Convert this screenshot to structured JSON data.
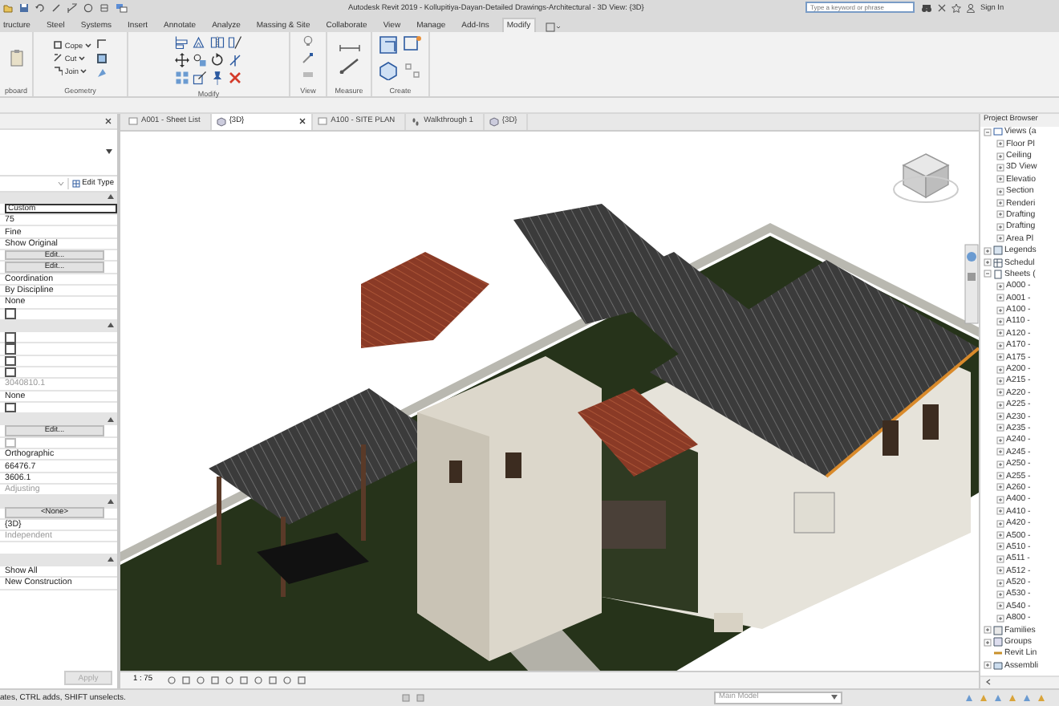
{
  "window": {
    "title": "Autodesk Revit 2019 - Kollupitiya-Dayan-Detailed Drawings-Architectural - 3D View: {3D}"
  },
  "search": {
    "placeholder": "Type a keyword or phrase"
  },
  "account": {
    "label": "Sign In"
  },
  "ribbon": {
    "tabs": [
      {
        "label": "tructure",
        "selected": false
      },
      {
        "label": "Steel",
        "selected": false
      },
      {
        "label": "Systems",
        "selected": false
      },
      {
        "label": "Insert",
        "selected": false
      },
      {
        "label": "Annotate",
        "selected": false
      },
      {
        "label": "Analyze",
        "selected": false
      },
      {
        "label": "Massing & Site",
        "selected": false
      },
      {
        "label": "Collaborate",
        "selected": false
      },
      {
        "label": "View",
        "selected": false
      },
      {
        "label": "Manage",
        "selected": false
      },
      {
        "label": "Add-Ins",
        "selected": false
      },
      {
        "label": "Modify",
        "selected": true
      }
    ],
    "panels": [
      {
        "label": "pboard",
        "kind": "clipboard"
      },
      {
        "label": "Geometry",
        "kind": "geometry",
        "tools": [
          "Cope",
          "Cut",
          "Join"
        ]
      },
      {
        "label": "Modify",
        "kind": "modify"
      },
      {
        "label": "View",
        "kind": "view"
      },
      {
        "label": "Measure",
        "kind": "measure"
      },
      {
        "label": "Create",
        "kind": "create"
      }
    ]
  },
  "properties": {
    "edit_type": "Edit Type",
    "rows": [
      {
        "kind": "header",
        "expanded": true
      },
      {
        "kind": "field",
        "value": "Custom"
      },
      {
        "kind": "text",
        "value": "75",
        "disabled": false
      },
      {
        "kind": "text",
        "value": "Fine",
        "disabled": false
      },
      {
        "kind": "text",
        "value": "Show Original",
        "disabled": false
      },
      {
        "kind": "button",
        "value": "Edit..."
      },
      {
        "kind": "button",
        "value": "Edit..."
      },
      {
        "kind": "text",
        "value": "Coordination",
        "disabled": false
      },
      {
        "kind": "text",
        "value": "By Discipline",
        "disabled": false
      },
      {
        "kind": "text",
        "value": "None",
        "disabled": false
      },
      {
        "kind": "checkbox",
        "checked": false,
        "disabled": false
      },
      {
        "kind": "header",
        "expanded": true
      },
      {
        "kind": "checkbox",
        "checked": false,
        "disabled": false
      },
      {
        "kind": "checkbox",
        "checked": false,
        "disabled": false
      },
      {
        "kind": "checkbox",
        "checked": false,
        "disabled": false
      },
      {
        "kind": "checkbox",
        "checked": false,
        "disabled": false
      },
      {
        "kind": "text",
        "value": "3040810.1",
        "disabled": true
      },
      {
        "kind": "text",
        "value": "None",
        "disabled": false
      },
      {
        "kind": "checkbox",
        "checked": false,
        "disabled": false
      },
      {
        "kind": "header",
        "expanded": true
      },
      {
        "kind": "button",
        "value": "Edit..."
      },
      {
        "kind": "checkbox",
        "checked": false,
        "disabled": true
      },
      {
        "kind": "text",
        "value": "Orthographic",
        "disabled": false
      },
      {
        "kind": "text",
        "value": "66476.7",
        "disabled": false
      },
      {
        "kind": "text",
        "value": "3606.1",
        "disabled": false
      },
      {
        "kind": "text",
        "value": "Adjusting",
        "disabled": true
      },
      {
        "kind": "header",
        "expanded": true
      },
      {
        "kind": "button",
        "value": "<None>"
      },
      {
        "kind": "text",
        "value": "{3D}",
        "disabled": false
      },
      {
        "kind": "text",
        "value": "Independent",
        "disabled": true
      },
      {
        "kind": "blank"
      },
      {
        "kind": "header",
        "expanded": true
      },
      {
        "kind": "text",
        "value": "Show All",
        "disabled": false
      },
      {
        "kind": "text",
        "value": "New Construction",
        "disabled": false
      }
    ],
    "apply": {
      "label": "Apply",
      "disabled": true
    }
  },
  "view_tabs": [
    {
      "label": "A001 - Sheet List",
      "kind": "sheet",
      "selected": false
    },
    {
      "label": "{3D}",
      "kind": "model",
      "selected": true
    },
    {
      "label": "A100 - SITE PLAN",
      "kind": "sheet",
      "selected": false
    },
    {
      "label": "Walkthrough 1",
      "kind": "walkthrough",
      "selected": false
    },
    {
      "label": "{3D}",
      "kind": "model",
      "selected": false
    }
  ],
  "view": {
    "scale": "1 : 75"
  },
  "project_browser": {
    "title": "Project Browser",
    "tree": [
      {
        "label": "Views (a",
        "kind": "views",
        "expanded": true,
        "children": [
          {
            "label": "Floor Pl",
            "expanded": false
          },
          {
            "label": "Ceiling",
            "expanded": false
          },
          {
            "label": "3D View",
            "expanded": false
          },
          {
            "label": "Elevatio",
            "expanded": false
          },
          {
            "label": "Section",
            "expanded": false
          },
          {
            "label": "Renderi",
            "expanded": false
          },
          {
            "label": "Drafting",
            "expanded": false
          },
          {
            "label": "Drafting",
            "expanded": false
          },
          {
            "label": "Area Pl",
            "expanded": false
          }
        ]
      },
      {
        "label": "Legends",
        "kind": "legends",
        "expanded": false
      },
      {
        "label": "Schedul",
        "kind": "schedules",
        "expanded": false
      },
      {
        "label": "Sheets (",
        "kind": "sheets",
        "expanded": true,
        "children": [
          {
            "label": "A000 -",
            "expanded": false
          },
          {
            "label": "A001 -",
            "expanded": false
          },
          {
            "label": "A100 -",
            "expanded": false
          },
          {
            "label": "A110 -",
            "expanded": false
          },
          {
            "label": "A120 -",
            "expanded": false
          },
          {
            "label": "A170 -",
            "expanded": false
          },
          {
            "label": "A175 -",
            "expanded": false
          },
          {
            "label": "A200 -",
            "expanded": false
          },
          {
            "label": "A215 -",
            "expanded": false
          },
          {
            "label": "A220 -",
            "expanded": false
          },
          {
            "label": "A225 -",
            "expanded": false
          },
          {
            "label": "A230 -",
            "expanded": false
          },
          {
            "label": "A235 -",
            "expanded": false
          },
          {
            "label": "A240 -",
            "expanded": false
          },
          {
            "label": "A245 -",
            "expanded": false
          },
          {
            "label": "A250 -",
            "expanded": false
          },
          {
            "label": "A255 -",
            "expanded": false
          },
          {
            "label": "A260 -",
            "expanded": false
          },
          {
            "label": "A400 -",
            "expanded": false
          },
          {
            "label": "A410 -",
            "expanded": false
          },
          {
            "label": "A420 -",
            "expanded": false
          },
          {
            "label": "A500 -",
            "expanded": false
          },
          {
            "label": "A510 -",
            "expanded": false
          },
          {
            "label": "A511 -",
            "expanded": false
          },
          {
            "label": "A512 -",
            "expanded": false
          },
          {
            "label": "A520 -",
            "expanded": false
          },
          {
            "label": "A530 -",
            "expanded": false
          },
          {
            "label": "A540 -",
            "expanded": false
          },
          {
            "label": "A800 -",
            "expanded": false
          }
        ]
      },
      {
        "label": "Families",
        "kind": "families",
        "expanded": false
      },
      {
        "label": "Groups",
        "kind": "groups",
        "expanded": false
      },
      {
        "label": "Revit Lin",
        "kind": "links"
      },
      {
        "label": "Assembli",
        "kind": "assemblies",
        "expanded": false
      }
    ]
  },
  "status_bar": {
    "message": "ates, CTRL adds, SHIFT unselects.",
    "workset": "Main Model"
  }
}
